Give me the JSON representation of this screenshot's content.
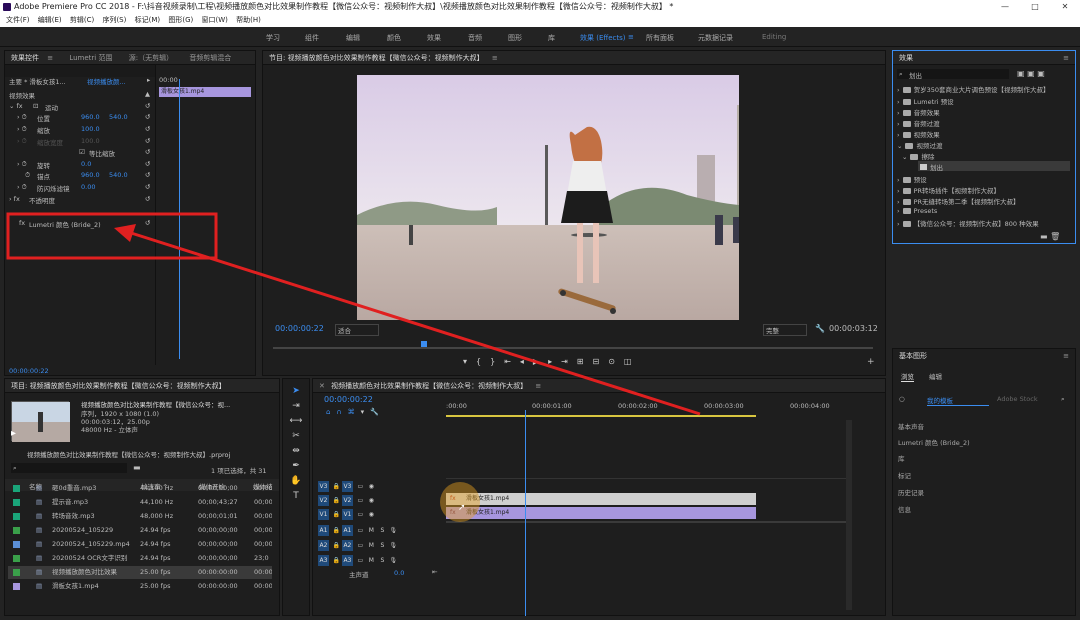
{
  "window": {
    "title": "Adobe Premiere Pro CC 2018 - F:\\抖音视频录制\\工程\\视频播放颜色对比效果制作教程【微信公众号：视频制作大叔】\\视频播放颜色对比效果制作教程【微信公众号：视频制作大叔】 *",
    "min": "—",
    "max": "□",
    "close": "✕"
  },
  "menu": [
    "文件(F)",
    "编辑(E)",
    "剪辑(C)",
    "序列(S)",
    "标记(M)",
    "图形(G)",
    "窗口(W)",
    "帮助(H)"
  ],
  "workspaces": [
    "学习",
    "组件",
    "编辑",
    "颜色",
    "效果",
    "音频",
    "图形",
    "库",
    "效果 (Effects)",
    "所有面板",
    "元数据记录",
    "Editing"
  ],
  "effect_controls": {
    "tabs": [
      "效果控件",
      "Lumetri 范围",
      "源:（无剪辑）",
      "音频剪辑混合"
    ],
    "master_label": "主要 * 滑板女孩1...",
    "seq_label": "视频播放颜...",
    "timecode_top": "00:00",
    "clip_name": "滑板女孩1.mp4",
    "section_video": "视频效果",
    "motion": "运动",
    "position": "位置",
    "pos_x": "960.0",
    "pos_y": "540.0",
    "scale": "缩放",
    "scale_v": "100.0",
    "scale_w": "缩放宽度",
    "scale_w_v": "100.0",
    "uniform": "等比缩放",
    "rotation": "旋转",
    "rotation_v": "0.0",
    "anchor": "锚点",
    "anchor_x": "960.0",
    "anchor_y": "540.0",
    "flicker": "防闪烁滤镜",
    "flicker_v": "0.00",
    "opacity": "不透明度",
    "lumetri": "Lumetri 颜色 (Bride_2)",
    "timecode": "00:00:00:22"
  },
  "program": {
    "title": "节目: 视频播放颜色对比效果制作教程【微信公众号：视频制作大叔】",
    "timecode": "00:00:00:22",
    "fit": "适合",
    "quality": "完整",
    "duration": "00:00:03:12"
  },
  "effects_panel": {
    "title": "效果",
    "search": "划出",
    "items": [
      "贺岁350套商业大片调色预设【视频制作大叔】",
      "Lumetri 预设",
      "音频效果",
      "音频过渡",
      "视频效果",
      "视频过渡",
      "擦除",
      "划出",
      "预设",
      "PR转场插件【视频制作大叔】",
      "PR无缝转场第二季【视频制作大叔】",
      "Presets",
      "【微信公众号：视频制作大叔】800 种效果"
    ]
  },
  "essential_graphics": {
    "title": "基本图形",
    "tabs": [
      "浏览",
      "编辑"
    ],
    "template_dropdown": "我的模板",
    "stock": "Adobe Stock",
    "panels": [
      "基本声音",
      "Lumetri 颜色 (Bride_2)",
      "库",
      "标记",
      "历史记录",
      "信息"
    ]
  },
  "project": {
    "title": "项目: 视频播放颜色对比效果制作教程【微信公众号：视频制作大叔】",
    "clip_info": [
      "视频播放颜色对比效果制作教程【微信公众号：视...",
      "序列，1920 x 1080 (1.0)",
      "00:00:03:12，25.00p",
      "48000 Hz - 立体声"
    ],
    "file": "视频播放颜色对比效果制作教程【微信公众号：视频制作大叔】.prproj",
    "selection": "1 项已选择，共 31",
    "headers": [
      "名称",
      "帧速率 ^",
      "媒体开始",
      "媒体结"
    ],
    "rows": [
      {
        "name": "砸0d重音.mp3",
        "rate": "44,100 Hz",
        "start": "00;00;00;00",
        "end": "00;00",
        "color": "#1aa57a"
      },
      {
        "name": "提示音.mp3",
        "rate": "44,100 Hz",
        "start": "00;00;43;27",
        "end": "00;00",
        "color": "#1aa57a"
      },
      {
        "name": "转场音效.mp3",
        "rate": "48,000 Hz",
        "start": "00;00;01;01",
        "end": "00;00",
        "color": "#1aa57a"
      },
      {
        "name": "20200524_105229",
        "rate": "24.94 fps",
        "start": "00;00;00;00",
        "end": "00;00",
        "color": "#3aa04a"
      },
      {
        "name": "20200524_105229.mp4",
        "rate": "24.94 fps",
        "start": "00;00;00;00",
        "end": "00;00",
        "color": "#5b8fd6"
      },
      {
        "name": "20200524 OCR文字识别",
        "rate": "24.94 fps",
        "start": "00;00;00;00",
        "end": "23;0",
        "color": "#3aa04a"
      },
      {
        "name": "视频播放颜色对比效果",
        "rate": "25.00 fps",
        "start": "00:00:00:00",
        "end": "00:00",
        "color": "#3aa04a"
      },
      {
        "name": "滑板女孩1.mp4",
        "rate": "25.00 fps",
        "start": "00:00:00:00",
        "end": "00:00",
        "color": "#a796de"
      }
    ]
  },
  "timeline": {
    "title": "视频播放颜色对比效果制作教程【微信公众号：视频制作大叔】",
    "timecode": "00:00:00:22",
    "ruler": [
      ":00:00",
      "00:00:01:00",
      "00:00:02:00",
      "00:00:03:00",
      "00:00:04:00"
    ],
    "video_tracks": [
      "V3",
      "V2",
      "V1"
    ],
    "audio_tracks": [
      "A1",
      "A2",
      "A3"
    ],
    "master": "主声道",
    "master_v": "0.0",
    "clip_v2": "滑板女孩1.mp4",
    "clip_v1": "滑板女孩1.mp4",
    "playhead_fraction": 0.229
  },
  "colors": {
    "accent": "#3b8df0",
    "clip_purple": "#a796de",
    "clip_gray": "#cfcfcf",
    "annotation": "#e02020"
  }
}
